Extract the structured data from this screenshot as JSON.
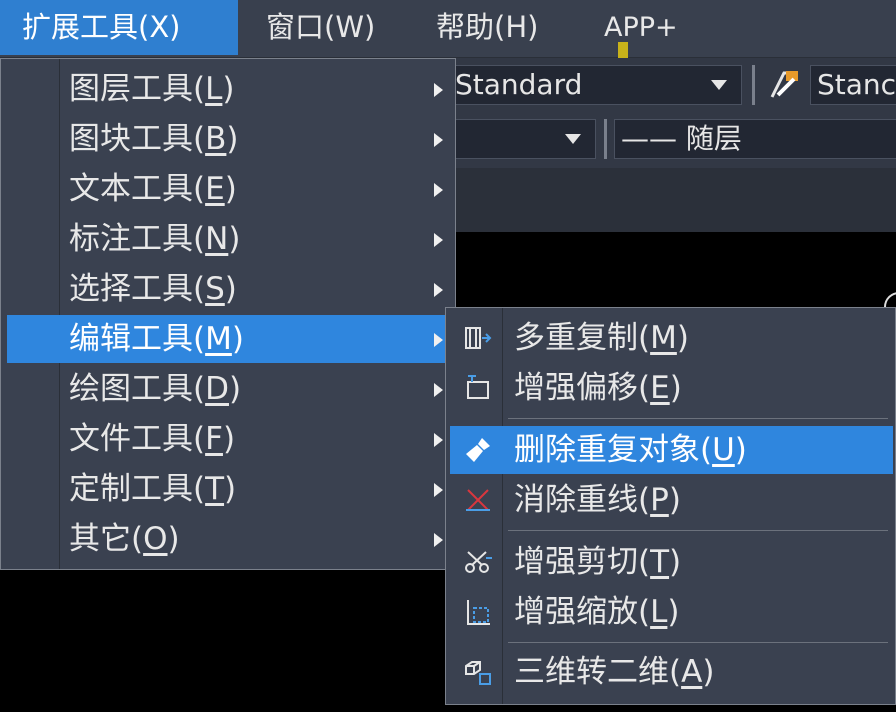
{
  "menubar": {
    "items": [
      {
        "label": "扩展工具(X)"
      },
      {
        "label": "窗口(W)"
      },
      {
        "label": "帮助(H)"
      },
      {
        "label": "APP+"
      }
    ]
  },
  "toolbar": {
    "text_style": "Standard",
    "dim_style_partial": "Stanc",
    "linetype": "—— 随层"
  },
  "menu": {
    "items": [
      {
        "label": "图层工具(",
        "key": "L",
        "end": ")"
      },
      {
        "label": "图块工具(",
        "key": "B",
        "end": ")"
      },
      {
        "label": "文本工具(",
        "key": "E",
        "end": ")"
      },
      {
        "label": "标注工具(",
        "key": "N",
        "end": ")"
      },
      {
        "label": "选择工具(",
        "key": "S",
        "end": ")"
      },
      {
        "label": "编辑工具(",
        "key": "M",
        "end": ")"
      },
      {
        "label": "绘图工具(",
        "key": "D",
        "end": ")"
      },
      {
        "label": "文件工具(",
        "key": "F",
        "end": ")"
      },
      {
        "label": "定制工具(",
        "key": "T",
        "end": ")"
      },
      {
        "label": "其它(",
        "key": "O",
        "end": ")"
      }
    ]
  },
  "submenu": {
    "items": [
      {
        "label": "多重复制(",
        "key": "M",
        "end": ")",
        "icon": "multi-copy-icon"
      },
      {
        "label": "增强偏移(",
        "key": "E",
        "end": ")",
        "icon": "offset-icon"
      },
      {
        "label": "删除重复对象(",
        "key": "U",
        "end": ")",
        "icon": "broom-icon"
      },
      {
        "label": "消除重线(",
        "key": "P",
        "end": ")",
        "icon": "overkill-icon"
      },
      {
        "label": "增强剪切(",
        "key": "T",
        "end": ")",
        "icon": "scissors-icon"
      },
      {
        "label": "增强缩放(",
        "key": "L",
        "end": ")",
        "icon": "scale-icon"
      },
      {
        "label": "三维转二维(",
        "key": "A",
        "end": ")",
        "icon": "3d-to-2d-icon"
      }
    ]
  },
  "colors": {
    "accent": "#2f86de",
    "menu_bg": "#3a4150",
    "menubar_bg": "#39404e"
  }
}
